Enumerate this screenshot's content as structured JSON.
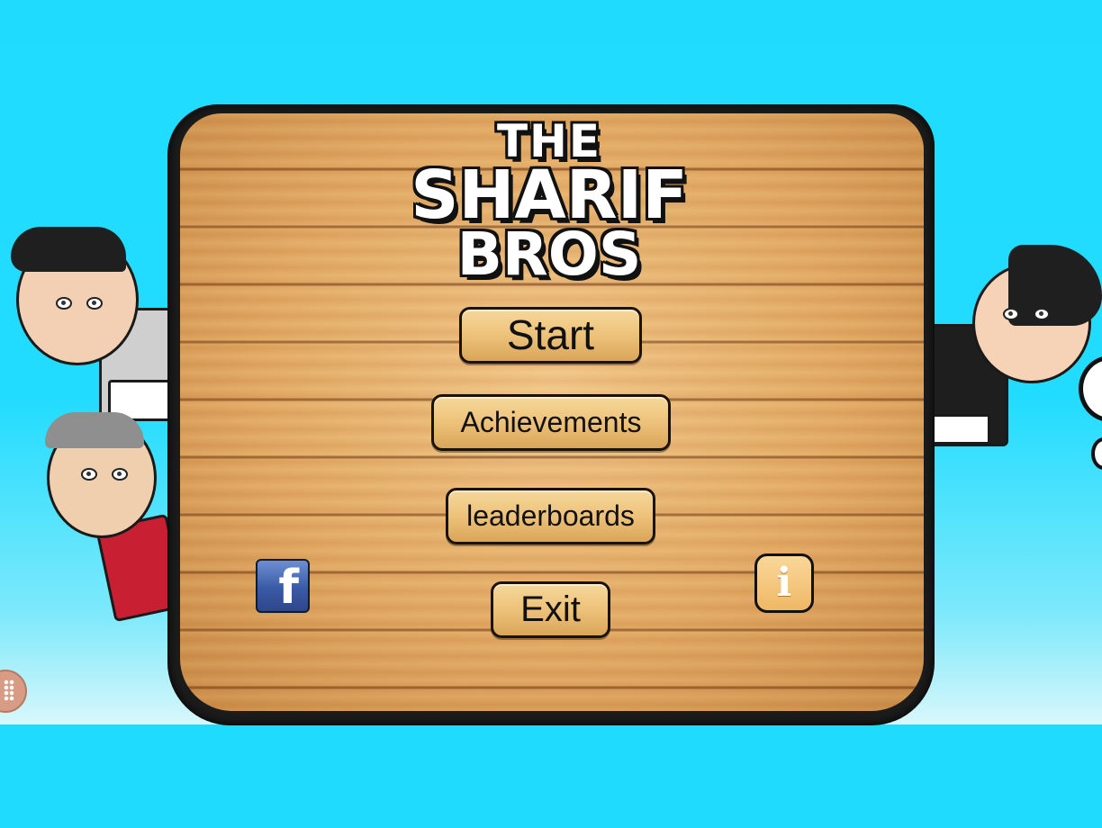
{
  "game": {
    "title": {
      "line1": "THE",
      "line2": "SHARIF",
      "line3": "BROS"
    }
  },
  "menu": {
    "start_label": "Start",
    "achievements_label": "Achievements",
    "leaderboards_label": "leaderboards",
    "exit_label": "Exit"
  },
  "social": {
    "facebook_glyph": "f",
    "facebook_icon": "facebook-icon"
  },
  "info": {
    "glyph": "i",
    "icon": "info-icon"
  },
  "colors": {
    "sky": "#1fdcff",
    "wood": "#e2a962",
    "button": "#edc27a",
    "facebook": "#3b5aa6"
  }
}
